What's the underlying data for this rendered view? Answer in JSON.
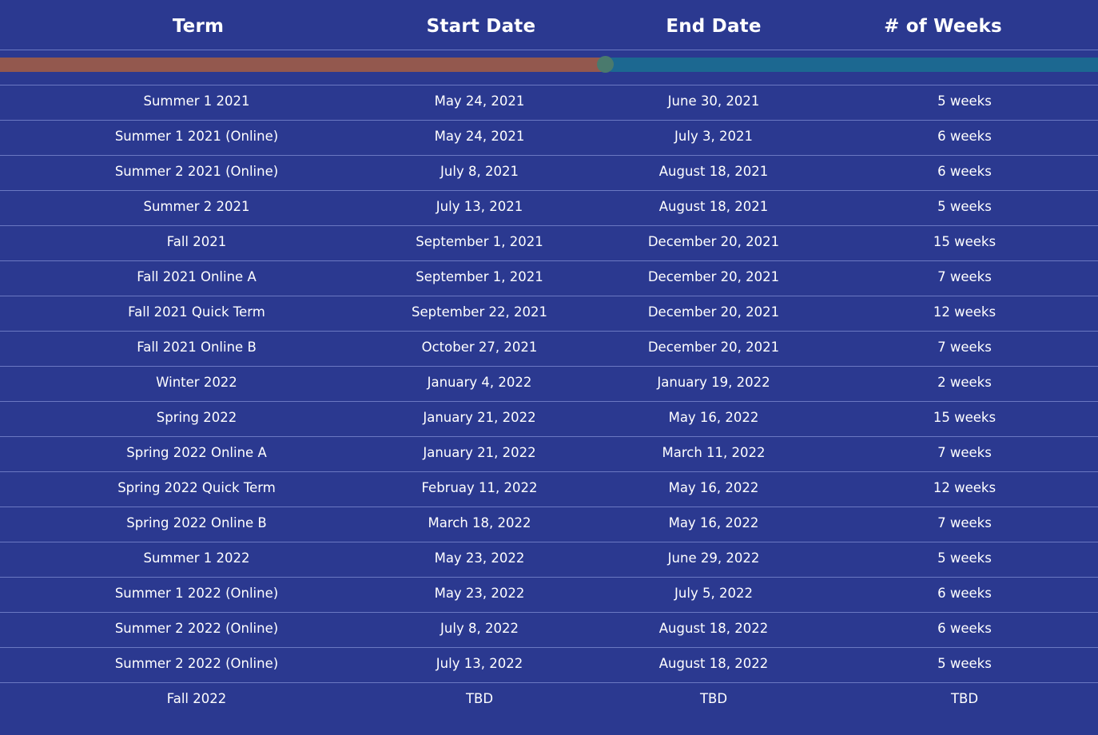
{
  "colors": {
    "background": "#2b3990",
    "divider": "#6b78c2",
    "progress_filled": "#93584e",
    "progress_remaining": "#1c6891",
    "progress_knob": "#4a7a6d",
    "text": "#ffffff"
  },
  "progress": {
    "fraction": 0.551
  },
  "table": {
    "headers": [
      "Term",
      "Start Date",
      "End Date",
      "# of Weeks"
    ],
    "rows": [
      [
        "Summer 1 2021",
        "May 24, 2021",
        "June 30, 2021",
        "5 weeks"
      ],
      [
        "Summer 1 2021 (Online)",
        "May 24, 2021",
        "July 3, 2021",
        "6 weeks"
      ],
      [
        "Summer 2 2021 (Online)",
        "July 8, 2021",
        "August 18, 2021",
        "6 weeks"
      ],
      [
        "Summer 2 2021",
        "July 13, 2021",
        "August 18, 2021",
        "5 weeks"
      ],
      [
        "Fall 2021",
        "September 1, 2021",
        "December 20, 2021",
        "15 weeks"
      ],
      [
        "Fall 2021 Online A",
        "September 1, 2021",
        "December 20, 2021",
        "7 weeks"
      ],
      [
        "Fall 2021 Quick Term",
        "September 22, 2021",
        "December 20, 2021",
        "12 weeks"
      ],
      [
        "Fall 2021 Online B",
        "October 27, 2021",
        "December 20, 2021",
        "7 weeks"
      ],
      [
        "Winter 2022",
        "January 4, 2022",
        "January 19, 2022",
        "2 weeks"
      ],
      [
        "Spring 2022",
        "January 21, 2022",
        "May 16, 2022",
        "15 weeks"
      ],
      [
        "Spring 2022 Online A",
        "January 21, 2022",
        "March 11, 2022",
        "7 weeks"
      ],
      [
        "Spring 2022 Quick Term",
        "Februay 11, 2022",
        "May 16, 2022",
        "12 weeks"
      ],
      [
        "Spring 2022 Online B",
        "March 18, 2022",
        "May 16, 2022",
        "7 weeks"
      ],
      [
        "Summer 1 2022",
        "May 23, 2022",
        "June 29, 2022",
        "5 weeks"
      ],
      [
        "Summer 1 2022 (Online)",
        "May 23, 2022",
        "July 5, 2022",
        "6 weeks"
      ],
      [
        "Summer 2 2022 (Online)",
        "July 8, 2022",
        "August 18, 2022",
        "6 weeks"
      ],
      [
        "Summer 2 2022 (Online)",
        "July 13, 2022",
        "August 18, 2022",
        "5 weeks"
      ],
      [
        "Fall 2022",
        "TBD",
        "TBD",
        "TBD"
      ]
    ]
  }
}
